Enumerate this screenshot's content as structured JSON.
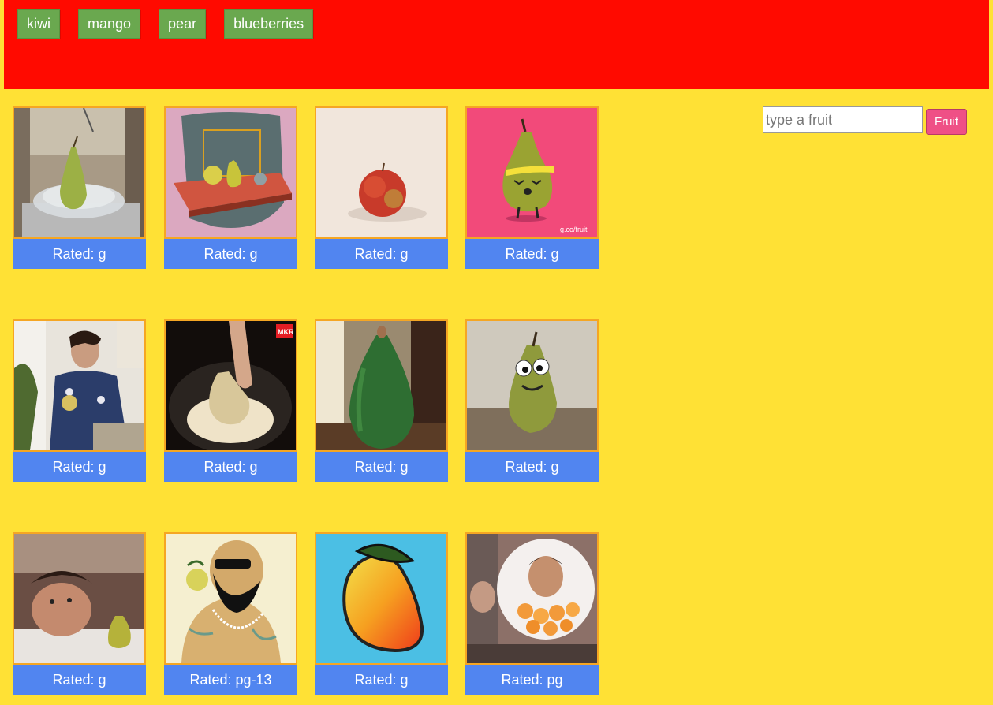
{
  "nav": {
    "tabs": [
      {
        "label": "kiwi"
      },
      {
        "label": "mango"
      },
      {
        "label": "pear"
      },
      {
        "label": "blueberries"
      }
    ]
  },
  "search": {
    "placeholder": "type a fruit",
    "value": "",
    "button_label": "Fruit"
  },
  "colors": {
    "page_background": "#ffe135",
    "top_bar": "#ff0a00",
    "tab_button": "#6aa84f",
    "rating_bar": "#5185f0",
    "thumbnail_border": "#f5a623",
    "search_button": "#ef5086"
  },
  "gifs": [
    {
      "rating": "Rated: g",
      "image": "pear-on-glass-plate"
    },
    {
      "rating": "Rated: g",
      "image": "pear-still-life"
    },
    {
      "rating": "Rated: g",
      "image": "red-apple"
    },
    {
      "rating": "Rated: g",
      "image": "cartoon-pear-workout",
      "caption": "g.co/fruit"
    },
    {
      "rating": "Rated: g",
      "image": "man-eating-pear"
    },
    {
      "rating": "Rated: g",
      "image": "poached-pear-bowl",
      "caption": "MKR"
    },
    {
      "rating": "Rated: g",
      "image": "person-pear-costume"
    },
    {
      "rating": "Rated: g",
      "image": "googly-eye-pear"
    },
    {
      "rating": "Rated: g",
      "image": "man-with-pear"
    },
    {
      "rating": "Rated: pg-13",
      "image": "rapper-eating-pear"
    },
    {
      "rating": "Rated: g",
      "image": "cartoon-mango"
    },
    {
      "rating": "Rated: pg",
      "image": "woman-oranges-dream"
    }
  ]
}
